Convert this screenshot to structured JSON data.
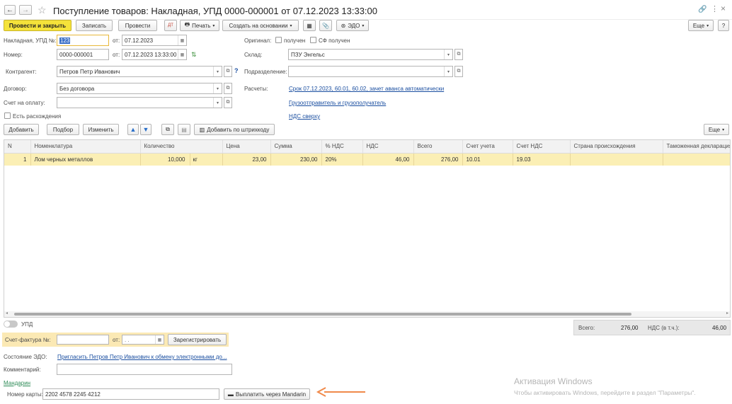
{
  "window": {
    "title": "Поступление товаров: Накладная, УПД 0000-000001 от 07.12.2023 13:33:00"
  },
  "toolbar": {
    "post_close": "Провести и закрыть",
    "save": "Записать",
    "post": "Провести",
    "print": "Печать",
    "create_based": "Создать на основании",
    "edo": "ЭДО",
    "more": "Еще",
    "help": "?"
  },
  "header": {
    "invoice_label": "Накладная, УПД №:",
    "invoice_no": "123",
    "from_label": "от:",
    "invoice_date": "07.12.2023",
    "number_label": "Номер:",
    "number": "0000-000001",
    "number_from_label": "от:",
    "number_date": "07.12.2023 13:33:00",
    "counterparty_label": "Контрагент:",
    "counterparty": "Петров Петр Иванович",
    "contract_label": "Договор:",
    "contract": "Без договора",
    "pay_invoice_label": "Счет на оплату:",
    "pay_invoice": "",
    "discrepancy_label": "Есть расхождения",
    "original_label": "Оригинал:",
    "received_label": "получен",
    "sf_received_label": "СФ получен",
    "warehouse_label": "Склад:",
    "warehouse": "ПЗУ Энгельс",
    "division_label": "Подразделение:",
    "division": "",
    "settlements_label": "Расчеты:",
    "settlements_link": "Срок 07.12.2023, 60.01, 60.02, зачет аванса автоматически",
    "shipper_link": "Грузоотправитель и грузополучатель",
    "vat_link": "НДС сверху"
  },
  "table_toolbar": {
    "add": "Добавить",
    "pick": "Подбор",
    "change": "Изменить",
    "barcode": "Добавить по штрихкоду",
    "more": "Еще"
  },
  "table": {
    "columns": [
      "N",
      "Номенклатура",
      "Количество",
      "Цена",
      "Сумма",
      "% НДС",
      "НДС",
      "Всего",
      "Счет учета",
      "Счет НДС",
      "Страна происхождения",
      "Таможенная декларация"
    ],
    "rows": [
      {
        "n": "1",
        "item": "Лом черных металлов",
        "qty": "10,000",
        "unit": "кг",
        "price": "23,00",
        "sum": "230,00",
        "vat_rate": "20%",
        "vat": "46,00",
        "total": "276,00",
        "account": "10.01",
        "vat_account": "19.03",
        "country": "",
        "declaration": ""
      }
    ]
  },
  "footer": {
    "upd_label": "УПД",
    "totals_label": "Всего:",
    "totals_value": "276,00",
    "vat_label": "НДС (в т.ч.):",
    "vat_value": "46,00",
    "sf_label": "Счет-фактура №:",
    "sf_from_label": "от:",
    "sf_date": " .  .",
    "register_btn": "Зарегистрировать",
    "edo_state_label": "Состояние ЭДО:",
    "edo_state_link": "Пригласить Петров Петр Иванович к обмену электронными до...",
    "comment_label": "Комментарий:",
    "comment": "",
    "mandarin_link": "Мандарин",
    "card_label": "Номер карты:",
    "card_number": "2202 4578 2245 4212",
    "pay_btn": "Выплатить через Mandarin"
  },
  "watermark": {
    "title": "Активация Windows",
    "subtitle": "Чтобы активировать Windows, перейдите в раздел \"Параметры\"."
  },
  "colors": {
    "primary_button": "#f5e33a",
    "selected_row": "#fbefb5",
    "link": "#1a4ea0",
    "arrow": "#f08a4b"
  }
}
